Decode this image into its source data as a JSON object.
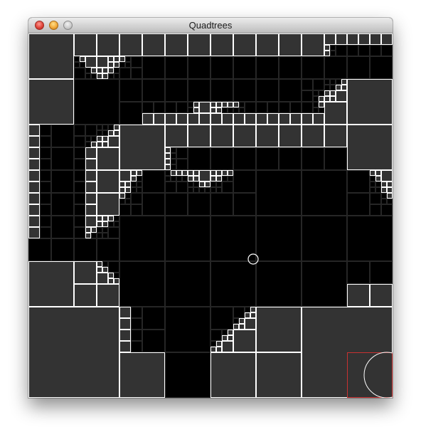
{
  "window": {
    "title": "Quadtrees",
    "buttons": [
      "close",
      "minimize",
      "zoom"
    ]
  },
  "canvas": {
    "colors": {
      "background": "#000000",
      "filled_cell": "#333333",
      "filled_border": "#ffffff",
      "empty_border": "#262626",
      "cursor_box": "#c83232",
      "cursor_circle": "#ffffff"
    },
    "cursor_circle": "cursor-circle-icon",
    "hover_region": "red-selection-box"
  }
}
